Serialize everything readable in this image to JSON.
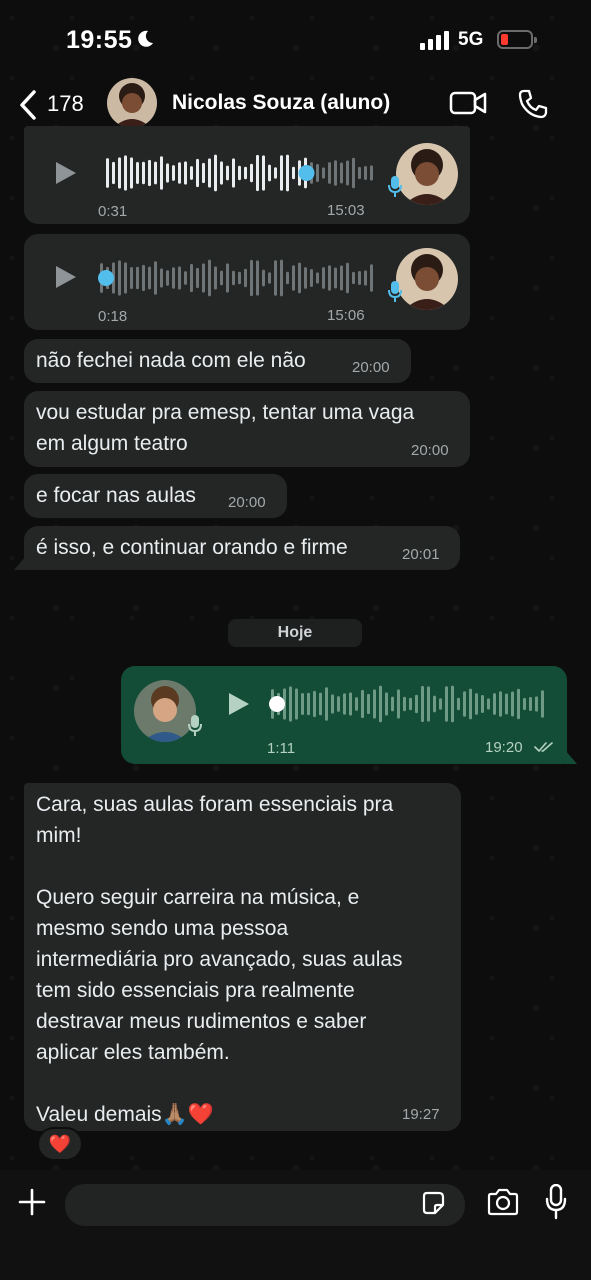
{
  "status_bar": {
    "time": "19:55",
    "network": "5G"
  },
  "header": {
    "back_count": "178",
    "contact_name": "Nicolas Souza (aluno)"
  },
  "messages": [
    {
      "kind": "audio",
      "direction": "in",
      "duration": "0:31",
      "time": "15:03",
      "progress": 0.75
    },
    {
      "kind": "audio",
      "direction": "in",
      "duration": "0:18",
      "time": "15:06",
      "progress": 0.0
    },
    {
      "kind": "text",
      "direction": "in",
      "text": "não fechei nada com ele não",
      "time": "20:00"
    },
    {
      "kind": "text",
      "direction": "in",
      "text": "vou estudar pra emesp, tentar uma vaga\nem algum teatro",
      "time": "20:00"
    },
    {
      "kind": "text",
      "direction": "in",
      "text": "e focar nas aulas",
      "time": "20:00"
    },
    {
      "kind": "text",
      "direction": "in",
      "text": "é isso, e continuar orando e firme",
      "time": "20:01"
    },
    {
      "kind": "date",
      "text": "Hoje"
    },
    {
      "kind": "audio",
      "direction": "out",
      "duration": "1:11",
      "time": "19:20",
      "progress": 0.0,
      "status": "read"
    },
    {
      "kind": "text",
      "direction": "in",
      "text": "Cara, suas aulas foram essenciais pra\nmim!\n\nQuero seguir carreira na música, e\nmesmo sendo uma pessoa\nintermediária pro avançado, suas aulas\ntem sido essenciais pra realmente\ndestravar meus rudimentos e saber\naplicar eles também.\n\nValeu demais🙏🏽❤️",
      "time": "19:27",
      "reaction": "❤️"
    }
  ],
  "input": {
    "placeholder": ""
  },
  "colors": {
    "incoming_bubble": "#242626",
    "outgoing_bubble": "#144d37",
    "accent_blue": "#53bdeb",
    "battery_low": "#ff3b30"
  }
}
